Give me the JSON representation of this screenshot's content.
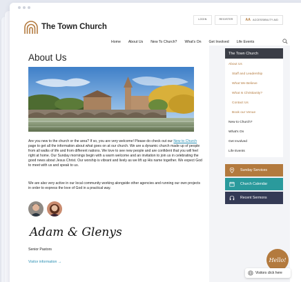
{
  "site": {
    "title": "The Town Church"
  },
  "utility": {
    "login": "LOGIN",
    "register": "REGISTER",
    "accessibility": "ACCESSIBILITY AID",
    "aa": "AA"
  },
  "nav": {
    "items": [
      "Home",
      "About Us",
      "New To Church?",
      "What's On",
      "Get Involved",
      "Life Events"
    ]
  },
  "main": {
    "title": "About Us",
    "para1_before": "Are you new to the church or the area? If so, you are very welcome! Please do check out our ",
    "para1_link": "New to Church",
    "para1_after": " page to get all the information about what goes on at our church. We are a dynamic church made up of people from all walks of life and from different nations. We love to see new people and are confident that you will feel right at home. Our Sunday mornings begin with a warm welcome and an invitation to join us in celebrating the good news about Jesus Christ. Our worship is vibrant and lively as we lift up His name together. We expect God to meet with us and speak to us.",
    "para2": "We are also very active in our local community working alongside other agencies and running our own projects in order to express the love of God in a practical way.",
    "signature": "Adam & Glenys",
    "role": "Senior Pastors",
    "visitor_link": "Visitor information →"
  },
  "sidebar": {
    "heading": "The Town Church",
    "items": [
      {
        "label": "About Us",
        "type": "active"
      },
      {
        "label": "Staff and Leadership",
        "type": "sub"
      },
      {
        "label": "What We Believe",
        "type": "sub"
      },
      {
        "label": "What Is Christianity?",
        "type": "sub"
      },
      {
        "label": "Contact Us",
        "type": "sub"
      },
      {
        "label": "Book our Venue",
        "type": "sub"
      },
      {
        "label": "New to Church?",
        "type": "normal"
      },
      {
        "label": "What's On",
        "type": "normal"
      },
      {
        "label": "Get Involved",
        "type": "normal"
      },
      {
        "label": "Life Events",
        "type": "normal"
      }
    ],
    "cta": [
      {
        "label": "Sunday Services",
        "icon": "map-pin-icon"
      },
      {
        "label": "Church Calendar",
        "icon": "calendar-icon"
      },
      {
        "label": "Recent Sermons",
        "icon": "headphones-icon"
      }
    ]
  },
  "widget": {
    "hello": "Hello!",
    "visitors": "Visitors click here"
  },
  "colors": {
    "accent": "#b37a3e",
    "teal": "#2a9a9c",
    "navy": "#343a55",
    "dark": "#3a3d46",
    "link": "#2a8fb3"
  }
}
